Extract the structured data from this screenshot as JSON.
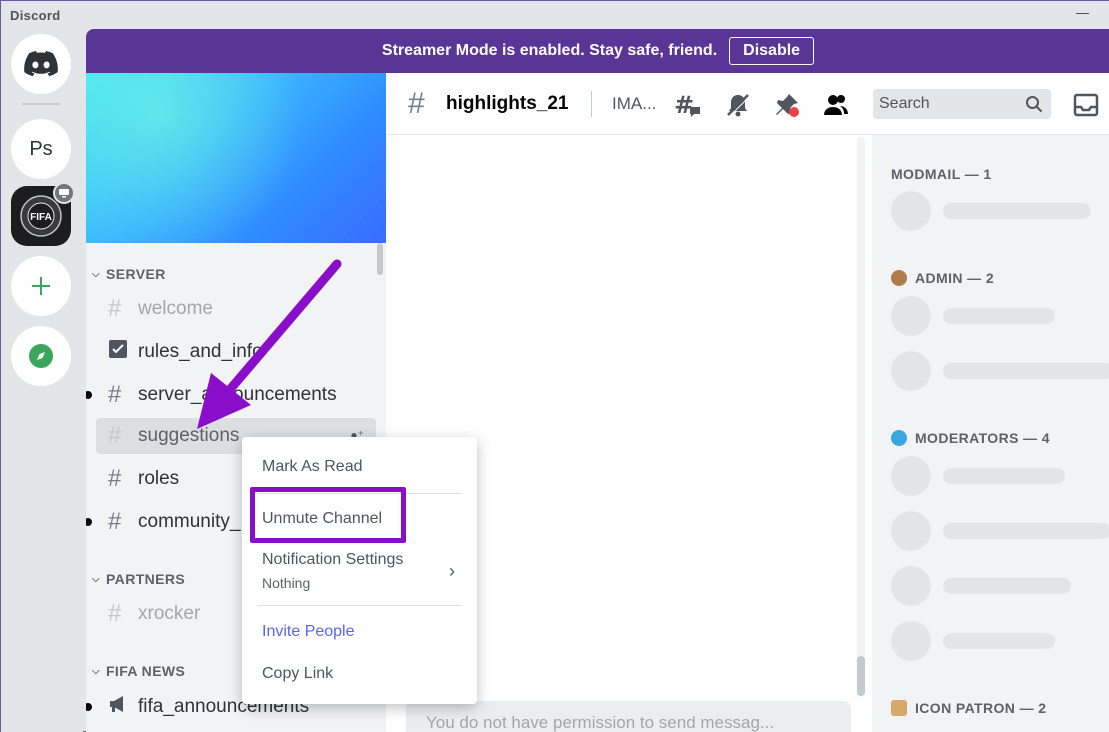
{
  "window": {
    "title": "Discord"
  },
  "streamer_banner": {
    "text": "Streamer Mode is enabled. Stay safe, friend.",
    "button": "Disable"
  },
  "servers": [
    {
      "name": "Discord Home",
      "icon": "discord-logo-icon"
    },
    {
      "name": "Ps",
      "label": "Ps"
    },
    {
      "name": "FIFA",
      "icon": "fifa-server-icon"
    },
    {
      "name": "Add a Server",
      "icon": "plus-icon"
    },
    {
      "name": "Explore",
      "icon": "compass-icon"
    }
  ],
  "sidebar": {
    "categories": [
      {
        "label": "SERVER"
      },
      {
        "label": "PARTNERS"
      },
      {
        "label": "FIFA NEWS"
      }
    ],
    "channels": [
      {
        "label": "welcome",
        "state": "muted"
      },
      {
        "label": "rules_and_info",
        "icon": "rules-icon"
      },
      {
        "label": "server_announcements",
        "unread": true
      },
      {
        "label": "suggestions",
        "state": "selected-muted"
      },
      {
        "label": "roles"
      },
      {
        "label": "community_",
        "unread": true
      },
      {
        "label": "xrocker",
        "state": "muted"
      },
      {
        "label": "fifa_announcements",
        "icon": "megaphone-icon",
        "unread": true
      }
    ]
  },
  "chat": {
    "channel_name": "highlights_21",
    "topic": "IMA...",
    "search_placeholder": "Search",
    "input_placeholder": "You do not have permission to send messag..."
  },
  "members": {
    "groups": [
      {
        "label": "MODMAIL — 1"
      },
      {
        "label": "ADMIN — 2"
      },
      {
        "label": "MODERATORS — 4"
      },
      {
        "label": "ICON PATRON — 2"
      }
    ]
  },
  "context_menu": {
    "mark_read": "Mark As Read",
    "unmute": "Unmute Channel",
    "notification_settings": "Notification Settings",
    "notification_value": "Nothing",
    "invite": "Invite People",
    "copy_link": "Copy Link"
  },
  "colors": {
    "accent": "#5865f2",
    "streamer_banner": "#593695",
    "highlight": "#8a0ec9"
  }
}
